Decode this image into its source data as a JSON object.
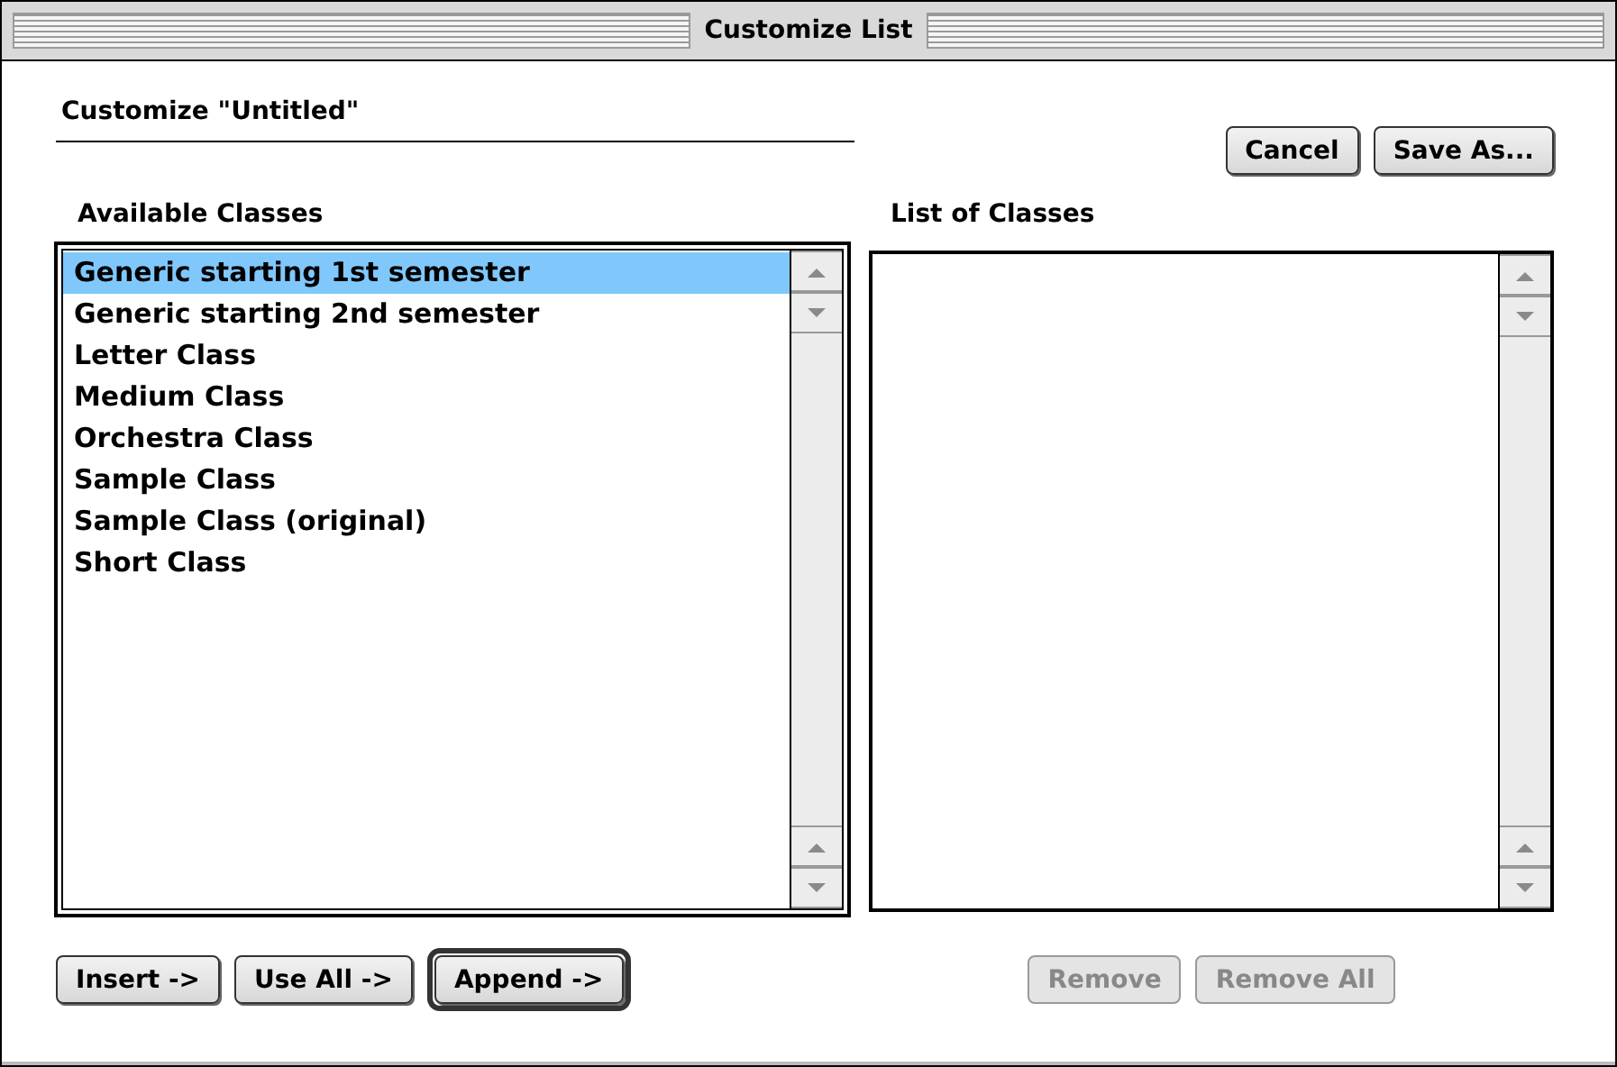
{
  "window": {
    "title": "Customize List"
  },
  "heading": "Customize \"Untitled\"",
  "top_buttons": [
    {
      "label": "Cancel",
      "default": false,
      "disabled": false
    },
    {
      "label": "Save As...",
      "default": false,
      "disabled": false
    }
  ],
  "lists": [
    {
      "label": "Available Classes",
      "focused": true,
      "items": [
        {
          "label": "Generic starting 1st semester",
          "selected": true
        },
        {
          "label": "Generic starting 2nd semester",
          "selected": false
        },
        {
          "label": "Letter Class",
          "selected": false
        },
        {
          "label": "Medium Class",
          "selected": false
        },
        {
          "label": "Orchestra Class",
          "selected": false
        },
        {
          "label": "Sample Class",
          "selected": false
        },
        {
          "label": "Sample Class (original)",
          "selected": false
        },
        {
          "label": "Short Class",
          "selected": false
        }
      ],
      "buttons": [
        {
          "label": "Insert ->",
          "default": false,
          "disabled": false
        },
        {
          "label": "Use All ->",
          "default": false,
          "disabled": false
        },
        {
          "label": "Append ->",
          "default": true,
          "disabled": false
        }
      ]
    },
    {
      "label": "List of Classes",
      "focused": false,
      "buttons": [
        {
          "label": "Remove",
          "default": false,
          "disabled": true
        },
        {
          "label": "Remove All",
          "default": false,
          "disabled": true
        }
      ]
    }
  ]
}
